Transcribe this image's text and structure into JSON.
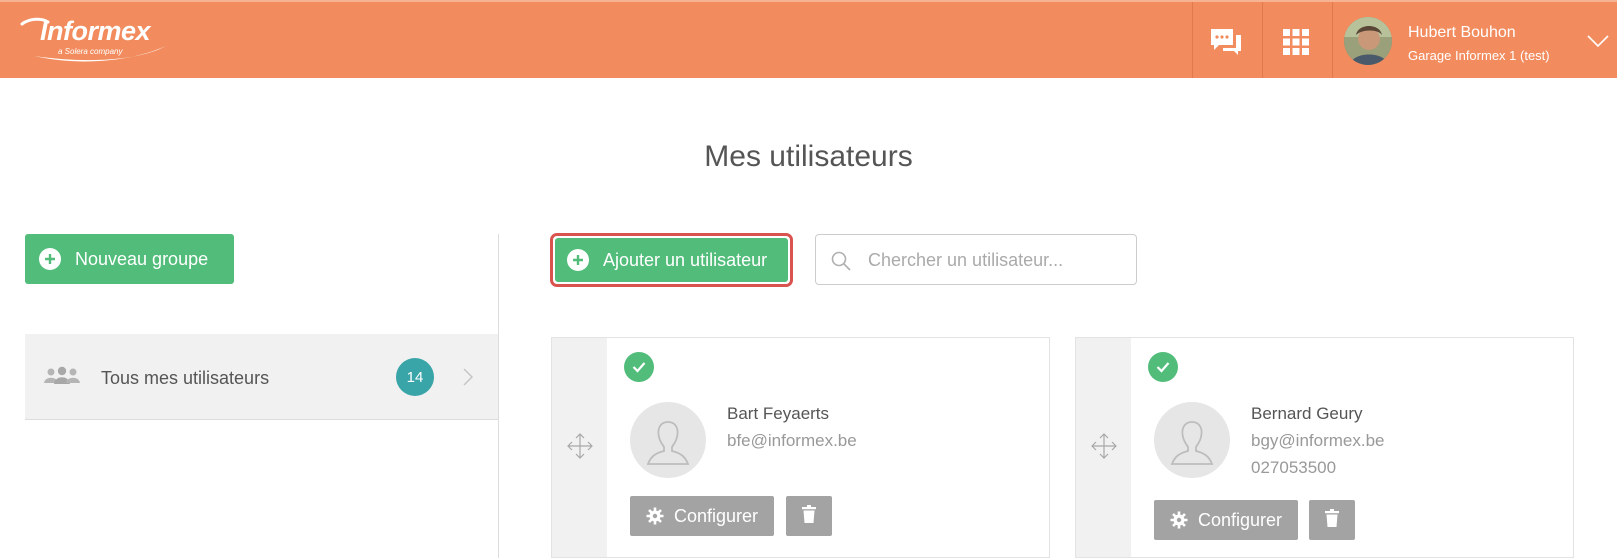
{
  "header": {
    "logo_text": "Informex",
    "logo_subtext": "a Solera company",
    "chat_icon": "chat-bubbles-icon",
    "apps_icon": "apps-grid-icon",
    "user_name": "Hubert Bouhon",
    "user_org": "Garage Informex 1 (test)",
    "menu_icon": "chevron-down-icon"
  },
  "page": {
    "title": "Mes utilisateurs"
  },
  "sidebar": {
    "new_group_label": "Nouveau groupe",
    "groups": [
      {
        "label": "Tous mes utilisateurs",
        "count": "14",
        "icon": "users-icon"
      }
    ]
  },
  "toolbar": {
    "add_user_label": "Ajouter un utilisateur",
    "search_placeholder": "Chercher un utilisateur..."
  },
  "users": [
    {
      "name": "Bart Feyaerts",
      "email": "bfe@informex.be",
      "phone": "",
      "active": true,
      "configure_label": "Configurer"
    },
    {
      "name": "Bernard Geury",
      "email": "bgy@informex.be",
      "phone": "027053500",
      "active": true,
      "configure_label": "Configurer"
    }
  ],
  "colors": {
    "header_bg": "#f28c5e",
    "primary_green": "#52bd7a",
    "badge_teal": "#3aa5a8",
    "highlight_red": "#d9534f",
    "button_grey": "#a3a3a3"
  }
}
